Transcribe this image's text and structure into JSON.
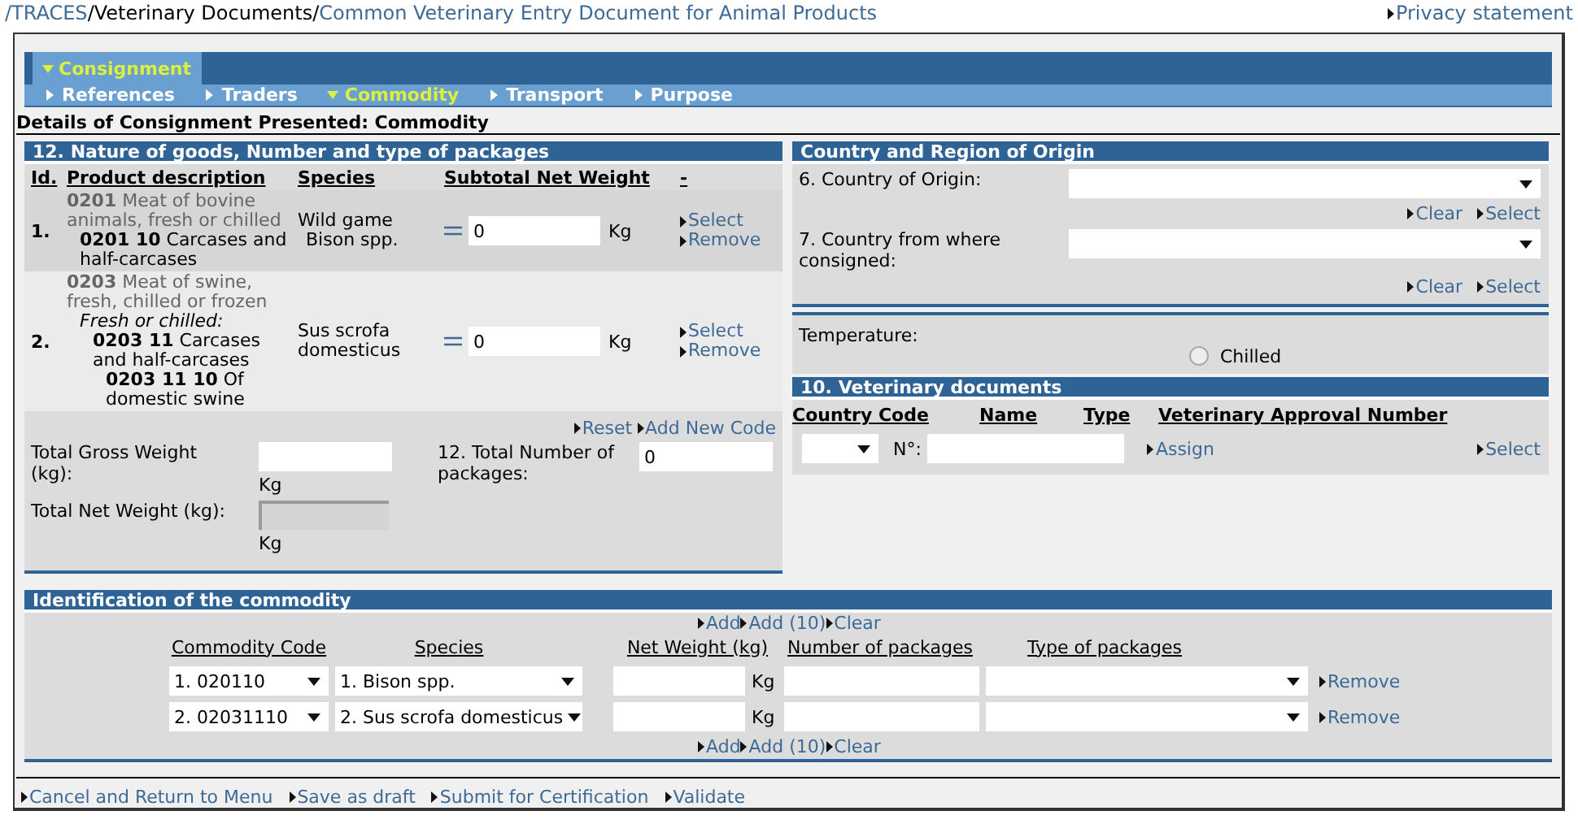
{
  "breadcrumb": [
    {
      "label": "/TRACES",
      "kind": "link"
    },
    {
      "label": "/Veterinary Documents/",
      "kind": "text"
    },
    {
      "label": "Common Veterinary Entry Document for Animal Products",
      "kind": "link"
    }
  ],
  "privacy_link": "Privacy statement",
  "main_tabs": [
    {
      "label": "Consignment",
      "selected": true
    }
  ],
  "sub_tabs": [
    {
      "label": "References",
      "selected": false
    },
    {
      "label": "Traders",
      "selected": false
    },
    {
      "label": "Commodity",
      "selected": true
    },
    {
      "label": "Transport",
      "selected": false
    },
    {
      "label": "Purpose",
      "selected": false
    }
  ],
  "page_heading": "Details of Consignment Presented: Commodity",
  "goods": {
    "title": "12. Nature of goods, Number and type of packages",
    "columns": [
      "Id.",
      "Product description",
      "Species",
      "Subtotal Net Weight",
      "-"
    ],
    "rows": [
      {
        "id": "1.",
        "description": [
          {
            "text": "**0201** Meat of bovine animals, fresh or chilled",
            "children": [
              {
                "text": "**0201 10** Carcases and half-carcases"
              }
            ]
          }
        ],
        "species": {
          "group": "Wild game",
          "name": "Bison spp."
        },
        "weight": "0",
        "unit": "Kg",
        "actions": [
          "Select",
          "Remove"
        ]
      },
      {
        "id": "2.",
        "description": [
          {
            "text": "**0203** Meat of swine, fresh, chilled or frozen",
            "children": [
              {
                "text": "Fresh or chilled:",
                "kind": "note",
                "children": [
                  {
                    "text": "**0203 11** Carcases and half-carcases",
                    "children": [
                      {
                        "text": "**0203 11 10** Of domestic swine"
                      }
                    ]
                  }
                ]
              }
            ]
          }
        ],
        "species": {
          "name": "Sus scrofa domesticus"
        },
        "weight": "0",
        "unit": "Kg",
        "actions": [
          "Select",
          "Remove"
        ]
      }
    ],
    "links": [
      "Reset",
      "Add New Code"
    ],
    "gross_weight": {
      "label": "Total Gross Weight (kg):",
      "unit": "Kg",
      "disabled": false
    },
    "total_packages": {
      "label": "12. Total Number of packages:",
      "value": "0"
    },
    "net_weight": {
      "label": "Total Net Weight (kg):",
      "unit": "Kg",
      "disabled": true
    }
  },
  "origin": {
    "title": "Country and Region of Origin",
    "fields": [
      {
        "label": "6. Country of Origin:",
        "links": [
          "Clear",
          "Select"
        ]
      },
      {
        "label": "7. Country from where consigned:",
        "links": [
          "Clear",
          "Select"
        ]
      }
    ]
  },
  "temperature": {
    "label": "Temperature:",
    "options": [
      {
        "label": "Chilled",
        "selected": false
      }
    ]
  },
  "vet_documents": {
    "title": "10. Veterinary documents",
    "columns": [
      "Country Code",
      "Name",
      "Type",
      "Veterinary Approval Number"
    ],
    "number_label": "N°:",
    "links": [
      "Assign",
      "Select"
    ]
  },
  "identification": {
    "title": "Identification of the commodity",
    "top_links": [
      "Add",
      "Add (10)",
      "Clear"
    ],
    "columns": [
      "Commodity Code",
      "Species",
      "Net Weight (kg)",
      "Number of packages",
      "Type of packages"
    ],
    "rows": [
      {
        "code": "1. 020110",
        "species": "1. Bison spp.",
        "unit": "Kg",
        "action": "Remove"
      },
      {
        "code": "2. 02031110",
        "species": "2. Sus scrofa domesticus",
        "unit": "Kg",
        "action": "Remove"
      }
    ],
    "bottom_links": [
      "Add",
      "Add (10)",
      "Clear"
    ]
  },
  "footer_links": [
    "Cancel and Return to Menu",
    "Save as draft",
    "Submit for Certification",
    "Validate"
  ]
}
